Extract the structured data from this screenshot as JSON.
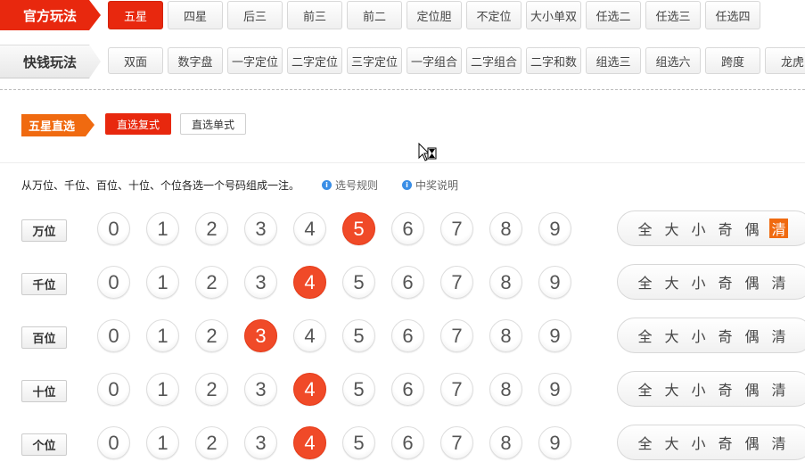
{
  "official": {
    "label": "官方玩法",
    "tabs": [
      "五星",
      "四星",
      "后三",
      "前三",
      "前二",
      "定位胆",
      "不定位",
      "大小单双",
      "任选二",
      "任选三",
      "任选四"
    ],
    "active_index": 0
  },
  "quick": {
    "label": "快钱玩法",
    "tabs": [
      "双面",
      "数字盘",
      "一字定位",
      "二字定位",
      "三字定位",
      "一字组合",
      "二字组合",
      "二字和数",
      "组选三",
      "组选六",
      "跨度",
      "龙虎"
    ]
  },
  "submode": {
    "tag": "五星直选",
    "options": [
      "直选复式",
      "直选单式"
    ],
    "active_index": 0
  },
  "instructions": {
    "text": "从万位、千位、百位、十位、个位各选一个号码组成一注。",
    "rule_link": "选号规则",
    "prize_link": "中奖说明"
  },
  "positions": [
    {
      "label": "万位",
      "selected": 5
    },
    {
      "label": "千位",
      "selected": 4
    },
    {
      "label": "百位",
      "selected": 3
    },
    {
      "label": "十位",
      "selected": 4
    },
    {
      "label": "个位",
      "selected": 4
    }
  ],
  "digits": [
    "0",
    "1",
    "2",
    "3",
    "4",
    "5",
    "6",
    "7",
    "8",
    "9"
  ],
  "quick_select": [
    "全",
    "大",
    "小",
    "奇",
    "偶",
    "清"
  ],
  "colors": {
    "accent": "#e8280e",
    "ball_selected": "#f04a28",
    "quick_active": "#f06a10"
  }
}
